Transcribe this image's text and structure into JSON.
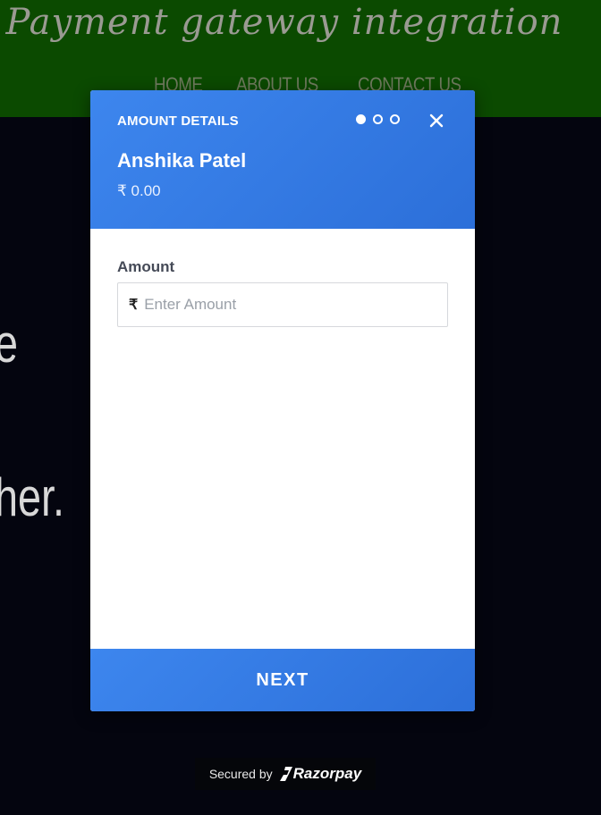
{
  "site": {
    "title": "Payment gateway integration",
    "nav": [
      "HOME",
      "ABOUT US",
      "CONTACT US"
    ],
    "background_text": [
      "e",
      "her."
    ]
  },
  "checkout": {
    "step_title": "AMOUNT DETAILS",
    "steps_total": 3,
    "active_step": 1,
    "merchant_name": "Anshika Patel",
    "header_amount": "₹ 0.00",
    "amount_label": "Amount",
    "currency_symbol": "₹",
    "amount_placeholder": "Enter Amount",
    "amount_value": "",
    "next_label": "NEXT",
    "icons": {
      "close": "close-icon",
      "currency": "rupee-icon"
    }
  },
  "footer": {
    "secured_by": "Secured by",
    "brand": "Razorpay"
  },
  "colors": {
    "header_green": "#0b4a00",
    "checkout_blue": "#3d86ee",
    "page_background": "#04050f"
  }
}
